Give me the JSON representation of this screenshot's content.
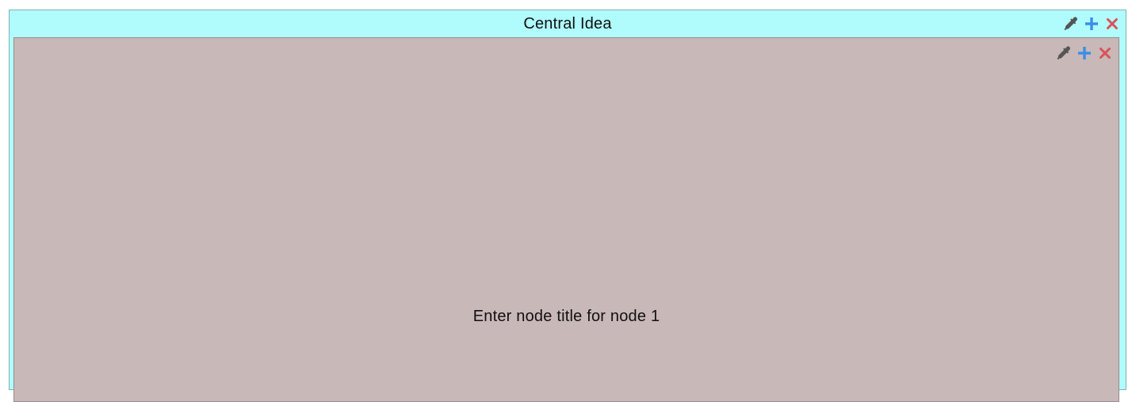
{
  "root_node": {
    "title": "Central Idea",
    "background_color": "#b0fbfc",
    "controls": [
      {
        "icon": "eyedropper-icon",
        "color": "#555555"
      },
      {
        "icon": "plus-icon",
        "color": "#3a8ee6"
      },
      {
        "icon": "close-icon",
        "color": "#d9535a"
      }
    ]
  },
  "child_node": {
    "title": "Enter node title for node 1",
    "background_color": "#c9b8b8",
    "controls": [
      {
        "icon": "eyedropper-icon",
        "color": "#555555"
      },
      {
        "icon": "plus-icon",
        "color": "#3a8ee6"
      },
      {
        "icon": "close-icon",
        "color": "#d9535a"
      }
    ]
  }
}
